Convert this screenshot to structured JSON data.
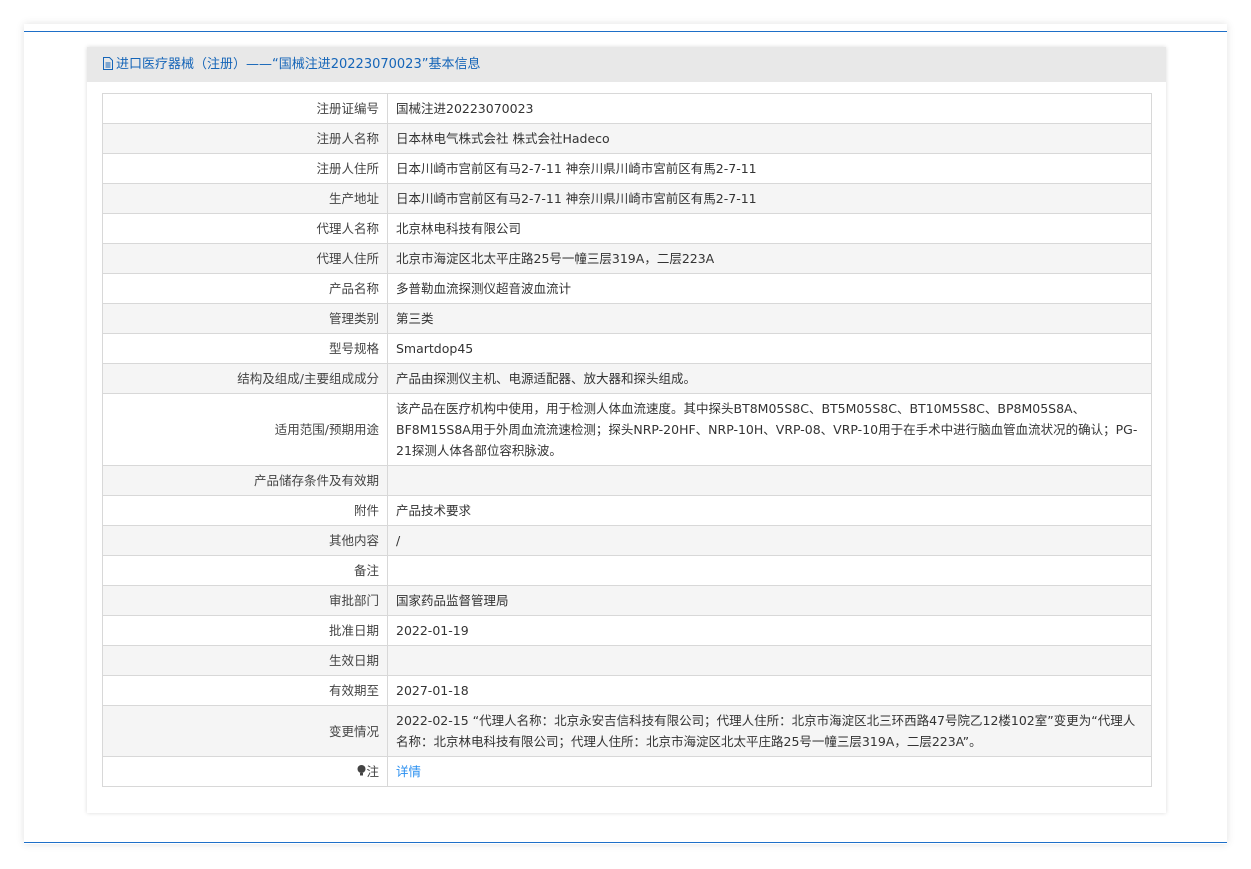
{
  "header": {
    "title": "进口医疗器械（注册）——“国械注进20223070023”基本信息"
  },
  "rows": [
    {
      "label": "注册证编号",
      "value": "国械注进20223070023"
    },
    {
      "label": "注册人名称",
      "value": "日本林电气株式会社 株式会社Hadeco"
    },
    {
      "label": "注册人住所",
      "value": "日本川崎市宫前区有马2-7-11 神奈川県川崎市宮前区有馬2-7-11"
    },
    {
      "label": "生产地址",
      "value": "日本川崎市宫前区有马2-7-11 神奈川県川崎市宮前区有馬2-7-11"
    },
    {
      "label": "代理人名称",
      "value": "北京林电科技有限公司"
    },
    {
      "label": "代理人住所",
      "value": "北京市海淀区北太平庄路25号一幢三层319A，二层223A"
    },
    {
      "label": "产品名称",
      "value": "多普勒血流探测仪超音波血流计"
    },
    {
      "label": "管理类别",
      "value": "第三类"
    },
    {
      "label": "型号规格",
      "value": "Smartdop45"
    },
    {
      "label": "结构及组成/主要组成成分",
      "value": "产品由探测仪主机、电源适配器、放大器和探头组成。"
    },
    {
      "label": "适用范围/预期用途",
      "value": "该产品在医疗机构中使用，用于检测人体血流速度。其中探头BT8M05S8C、BT5M05S8C、BT10M5S8C、BP8M05S8A、BF8M15S8A用于外周血流流速检测；探头NRP-20HF、NRP-10H、VRP-08、VRP-10用于在手术中进行脑血管血流状况的确认；PG-21探测人体各部位容积脉波。"
    },
    {
      "label": "产品储存条件及有效期",
      "value": ""
    },
    {
      "label": "附件",
      "value": "产品技术要求"
    },
    {
      "label": "其他内容",
      "value": "/"
    },
    {
      "label": "备注",
      "value": ""
    },
    {
      "label": "审批部门",
      "value": "国家药品监督管理局"
    },
    {
      "label": "批准日期",
      "value": "2022-01-19"
    },
    {
      "label": "生效日期",
      "value": ""
    },
    {
      "label": "有效期至",
      "value": "2027-01-18"
    },
    {
      "label": "变更情况",
      "value": "2022-02-15 “代理人名称：北京永安吉信科技有限公司；代理人住所：北京市海淀区北三环西路47号院乙12楼102室”变更为“代理人名称：北京林电科技有限公司；代理人住所：北京市海淀区北太平庄路25号一幢三层319A，二层223A”。"
    }
  ],
  "note": {
    "label": "注",
    "link": "详情"
  }
}
